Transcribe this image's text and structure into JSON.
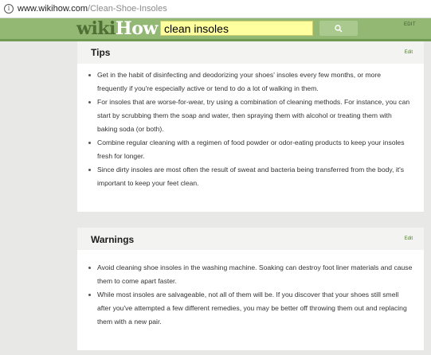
{
  "browser": {
    "info_icon": "info-icon",
    "url_host": "www.wikihow.com",
    "url_path": "/Clean-Shoe-Insoles"
  },
  "header": {
    "logo_wiki": "wiki",
    "logo_how": "How",
    "search_value": "clean insoles",
    "search_icon": "search-icon",
    "edit_label": "EDIT"
  },
  "tips": {
    "title": "Tips",
    "edit_label": "Edit",
    "items": [
      "Get in the habit of disinfecting and deodorizing your shoes' insoles every few months, or more frequently if you're especially active or tend to do a lot of walking in them.",
      "For insoles that are worse-for-wear, try using a combination of cleaning methods. For instance, you can start by scrubbing them the soap and water, then spraying them with alcohol or treating them with baking soda (or both).",
      "Combine regular cleaning with a regimen of food powder or odor-eating products to keep your insoles fresh for longer.",
      "Since dirty insoles are most often the result of sweat and bacteria being transferred from the body, it's important to keep your feet clean."
    ]
  },
  "warnings": {
    "title": "Warnings",
    "edit_label": "Edit",
    "items": [
      "Avoid cleaning shoe insoles in the washing machine. Soaking can destroy foot liner materials and cause them to come apart faster.",
      "While most insoles are salvageable, not all of them will be. If you discover that your shoes still smell after you've attempted a few different remedies, you may be better off throwing them out and replacing them with a new pair."
    ]
  },
  "colors": {
    "header_green": "#93b874",
    "logo_dark_green": "#4f6f35",
    "search_yellow": "#ffffa0",
    "page_bg": "#e8e8e6"
  }
}
